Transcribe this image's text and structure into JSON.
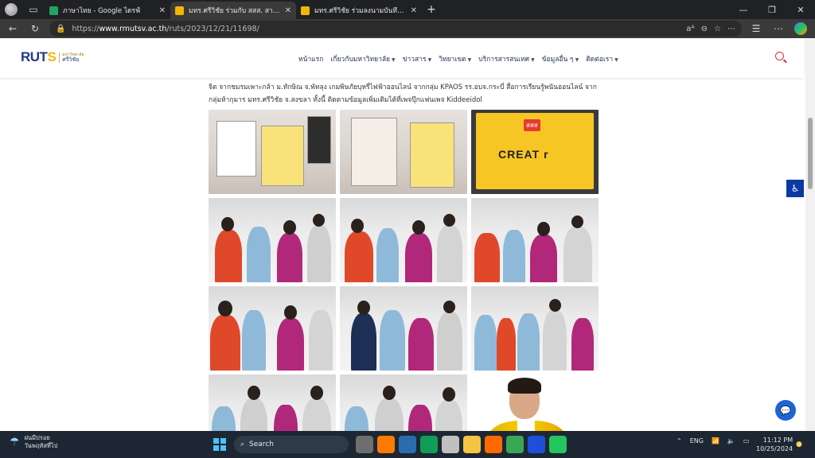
{
  "browser": {
    "tabs": [
      {
        "title": "ภาษาไทย - Google ไดรฟ์",
        "favicon_color": "#1fa463",
        "active": false
      },
      {
        "title": "มทร.ศรีวิชัย ร่วมกับ สสส. สานพลัง ภาคี",
        "favicon_color": "#f2b705",
        "active": true
      },
      {
        "title": "มทร.ศรีวิชัย ร่วมลงนามบันทึกความร่วมมื",
        "favicon_color": "#f2b705",
        "active": false
      }
    ],
    "new_tab_icon": "plus-icon",
    "url_prefix": "https://",
    "url_host": "www.rmutsv.ac.th",
    "url_path": "/ruts/2023/12/21/11698/"
  },
  "site": {
    "logo_text_a": "RUT",
    "logo_text_b": "S",
    "logo_sub_small": "มหาวิทยาลัย",
    "logo_sub_big": "ศรีวิชัย",
    "nav": [
      {
        "label": "หน้าแรก",
        "has_menu": false
      },
      {
        "label": "เกี่ยวกับมหาวิทยาลัย",
        "has_menu": true
      },
      {
        "label": "ข่าวสาร",
        "has_menu": true
      },
      {
        "label": "วิทยาเขต",
        "has_menu": true
      },
      {
        "label": "บริการสารสนเทศ",
        "has_menu": true
      },
      {
        "label": "ข้อมูลอื่น ๆ",
        "has_menu": true
      },
      {
        "label": "ติดต่อเรา",
        "has_menu": true
      }
    ],
    "accent_color": "#d83030",
    "brand_color": "#1e3a8a"
  },
  "article": {
    "paragraph_tail": "จิต จากชมรมเพาะกล้า ม.ทักษิณ จ.พัทลุง เกมพิษภัยบุหรี่ไฟฟ้าออนไลน์ จากกลุ่ม KPAOS รร.อบจ.กระบี่ สื่อการเรียนรู้พนันออนไลน์ จากกลุ่มห้ากุมาร มทร.ศรีวิชัย จ.สงขลา ทั้งนี้ ติดตามข้อมูลเพิ่มเติมได้ที่เพจปุ๊กแฟนเพจ Kiddeeidol"
  },
  "gallery": {
    "banner_text": "CREAT r",
    "banner_badge": "สสส",
    "photos": [
      {
        "scene": "poster"
      },
      {
        "scene": "poster"
      },
      {
        "scene": "banner"
      },
      {
        "scene": "crowd"
      },
      {
        "scene": "crowd"
      },
      {
        "scene": "crowd"
      },
      {
        "scene": "crowd"
      },
      {
        "scene": "crowd"
      },
      {
        "scene": "crowd"
      },
      {
        "scene": "crowd"
      },
      {
        "scene": "crowd"
      },
      {
        "scene": "portrait"
      }
    ]
  },
  "taskbar": {
    "weather_title": "ฝนมีปรอย",
    "weather_sub": "วันพฤหัสที่ไป",
    "search_placeholder": "Search",
    "lang": "ENG",
    "time": "11:12 PM",
    "date": "10/25/2024",
    "apps": [
      "#6e6e6e",
      "#ff7a00",
      "#2b6cb0",
      "#0f9d58",
      "#c0c0c0",
      "#f6c443",
      "#ff6a00",
      "#3aa757",
      "#1e4fd8",
      "#22c55e"
    ]
  }
}
